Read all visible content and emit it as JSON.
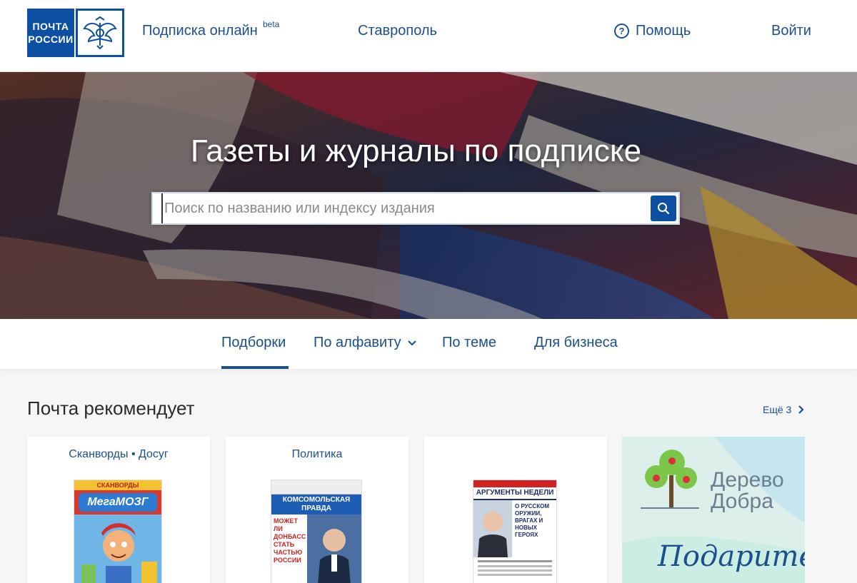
{
  "header": {
    "logo_line1": "ПОЧТА",
    "logo_line2": "РОССИИ",
    "subscription_link": "Подписка онлайн",
    "subscription_badge": "beta",
    "city": "Ставрополь",
    "help": "Помощь",
    "login": "Войти"
  },
  "hero": {
    "title": "Газеты и журналы по подписке",
    "search_placeholder": "Поиск по названию или индексу издания",
    "search_value": ""
  },
  "tabs": [
    {
      "label": "Подборки",
      "active": true
    },
    {
      "label": "По алфавиту",
      "has_dropdown": true
    },
    {
      "label": "По теме"
    },
    {
      "label": "Для бизнеса"
    }
  ],
  "recommend": {
    "title": "Почта рекомендует",
    "more": "Ещё 3",
    "cards": [
      {
        "category": "Сканворды • Досуг",
        "cover_title": "СКАНВОРДЫ",
        "cover_logo": "МегаМОЗГ"
      },
      {
        "category": "Политика",
        "cover_title": "КОМСОМОЛЬСКАЯ ПРАВДА",
        "cover_headline": "МОЖЕТ ЛИ ДОНБАСС СТАТЬ ЧАСТЬЮ РОССИИ"
      },
      {
        "category": "",
        "cover_title": "АРГУМЕНТЫ НЕДЕЛИ",
        "cover_headline": "О РУССКОМ ОРУЖИИ, ВРАГАХ И НОВЫХ ГЕРОЯХ"
      }
    ],
    "promo": {
      "line1": "Дерево",
      "line2": "Добра",
      "script": "Подарите"
    }
  },
  "colors": {
    "brand": "#0d4fa3",
    "link": "#1c4f8c"
  }
}
